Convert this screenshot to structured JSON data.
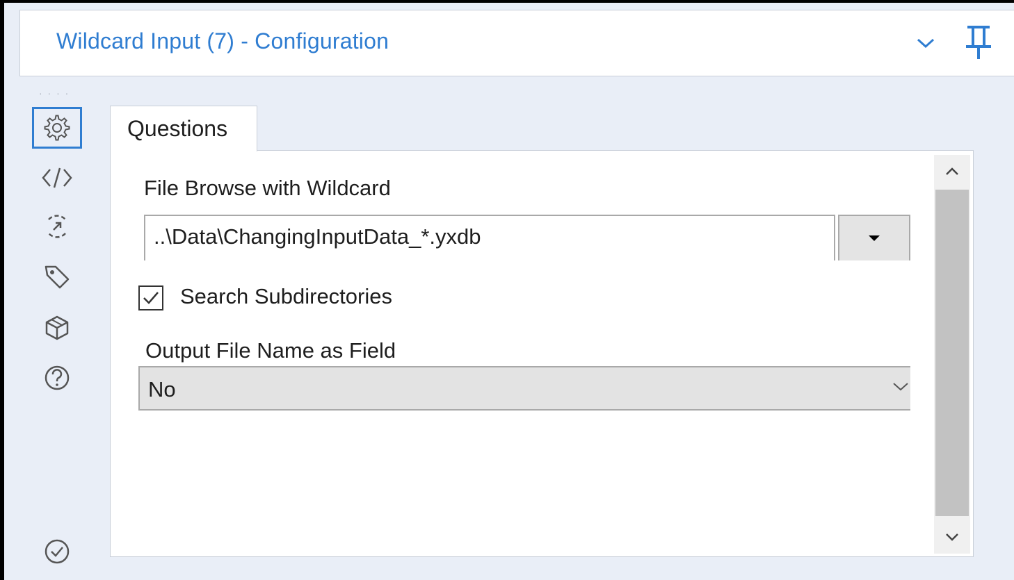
{
  "header": {
    "title": "Wildcard Input (7) - Configuration",
    "collapse_icon": "chevron-down-icon",
    "pin_icon": "pin-icon"
  },
  "sidebar": {
    "grip": "· · · ·",
    "items": [
      {
        "icon": "gear-icon",
        "name": "configuration",
        "active": true
      },
      {
        "icon": "code-icon",
        "name": "xml-view",
        "active": false
      },
      {
        "icon": "annotation-icon",
        "name": "annotation",
        "active": false
      },
      {
        "icon": "tag-icon",
        "name": "tags",
        "active": false
      },
      {
        "icon": "package-icon",
        "name": "package",
        "active": false
      },
      {
        "icon": "help-icon",
        "name": "help",
        "active": false
      }
    ],
    "bottom_icon": "check-circle-icon"
  },
  "tabs": [
    {
      "label": "Questions",
      "active": true
    }
  ],
  "form": {
    "file_browse_label": "File Browse with Wildcard",
    "file_browse_value": "..\\Data\\ChangingInputData_*.yxdb",
    "search_subdirectories_label": "Search Subdirectories",
    "search_subdirectories_checked": true,
    "output_file_name_label": "Output File Name as Field",
    "output_file_name_value": "No"
  },
  "colors": {
    "accent": "#2f7dd1",
    "background": "#e9eef7",
    "panel": "#ffffff"
  }
}
